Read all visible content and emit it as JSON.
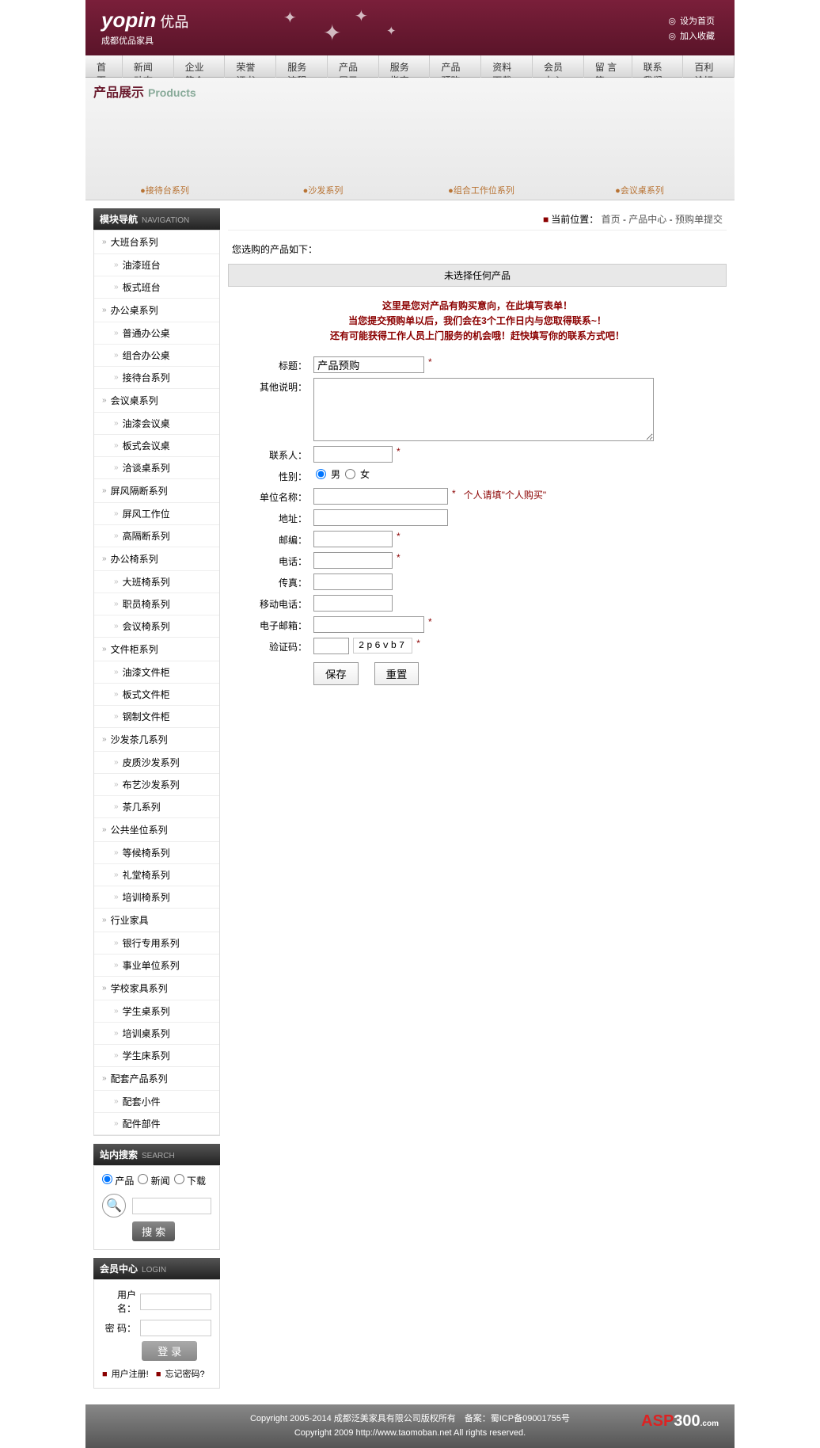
{
  "header": {
    "logo_en": "yopin",
    "logo_cn": "优品",
    "logo_sub": "成都优品家具",
    "link1": "设为首页",
    "link2": "加入收藏"
  },
  "nav": [
    "首页",
    "新闻动态",
    "企业简介",
    "荣誉证书",
    "服务流程",
    "产品展示",
    "服务指南",
    "产品预购",
    "资料下载",
    "会员中心",
    "留 言 簿",
    "联系我们",
    "百利论坛"
  ],
  "banner": {
    "title_cn": "产品展示",
    "title_en": "Products",
    "items": [
      "接待台系列",
      "沙发系列",
      "组合工作位系列",
      "会议桌系列"
    ]
  },
  "sidebar": {
    "nav_title": "模块导航",
    "nav_title_en": "NAVIGATION",
    "categories": [
      {
        "name": "大班台系列",
        "subs": [
          "油漆班台",
          "板式班台"
        ]
      },
      {
        "name": "办公桌系列",
        "subs": [
          "普通办公桌",
          "组合办公桌",
          "接待台系列"
        ]
      },
      {
        "name": "会议桌系列",
        "subs": [
          "油漆会议桌",
          "板式会议桌",
          "洽谈桌系列"
        ]
      },
      {
        "name": "屏风隔断系列",
        "subs": [
          "屏风工作位",
          "高隔断系列"
        ]
      },
      {
        "name": "办公椅系列",
        "subs": [
          "大班椅系列",
          "职员椅系列",
          "会议椅系列"
        ]
      },
      {
        "name": "文件柜系列",
        "subs": [
          "油漆文件柜",
          "板式文件柜",
          "钢制文件柜"
        ]
      },
      {
        "name": "沙发茶几系列",
        "subs": [
          "皮质沙发系列",
          "布艺沙发系列",
          "茶几系列"
        ]
      },
      {
        "name": "公共坐位系列",
        "subs": [
          "等候椅系列",
          "礼堂椅系列",
          "培训椅系列"
        ]
      },
      {
        "name": "行业家具",
        "subs": [
          "银行专用系列",
          "事业单位系列"
        ]
      },
      {
        "name": "学校家具系列",
        "subs": [
          "学生桌系列",
          "培训桌系列",
          "学生床系列"
        ]
      },
      {
        "name": "配套产品系列",
        "subs": [
          "配套小件",
          "配件部件"
        ]
      }
    ],
    "search_title": "站内搜索",
    "search_title_en": "SEARCH",
    "search_opts": [
      "产品",
      "新闻",
      "下载"
    ],
    "search_btn": "搜 索",
    "login_title": "会员中心",
    "login_title_en": "LOGIN",
    "login_user": "用户名：",
    "login_pass": "密  码：",
    "login_btn": "登 录",
    "login_reg": "用户注册!",
    "login_forgot": "忘记密码?"
  },
  "breadcrumb": {
    "label": "当前位置：",
    "links": [
      "首页",
      "产品中心",
      "预购单提交"
    ]
  },
  "content": {
    "selected_label": "您选购的产品如下：",
    "no_select": "未选择任何产品",
    "notice1": "这里是您对产品有购买意向，在此填写表单！",
    "notice2": "当您提交预购单以后，我们会在3个工作日内与您取得联系~！",
    "notice3": "还有可能获得工作人员上门服务的机会哦！赶快填写你的联系方式吧！"
  },
  "form": {
    "title_label": "标题：",
    "title_value": "产品预购",
    "desc_label": "其他说明：",
    "contact_label": "联系人：",
    "gender_label": "性别：",
    "gender_m": "男",
    "gender_f": "女",
    "company_label": "单位名称：",
    "company_hint": "个人请填\"个人购买\"",
    "addr_label": "地址：",
    "zip_label": "邮编：",
    "phone_label": "电话：",
    "fax_label": "传真：",
    "mobile_label": "移动电话：",
    "email_label": "电子邮箱：",
    "captcha_label": "验证码：",
    "captcha_value": "2p6vb7",
    "save_btn": "保存",
    "reset_btn": "重置"
  },
  "footer": {
    "line1": "Copyright 2005-2014 成都泛美家具有限公司版权所有　备案：蜀ICP备09001755号",
    "line2": "Copyright 2009 http://www.taomoban.net All rights reserved.",
    "logo": "ASP300"
  }
}
